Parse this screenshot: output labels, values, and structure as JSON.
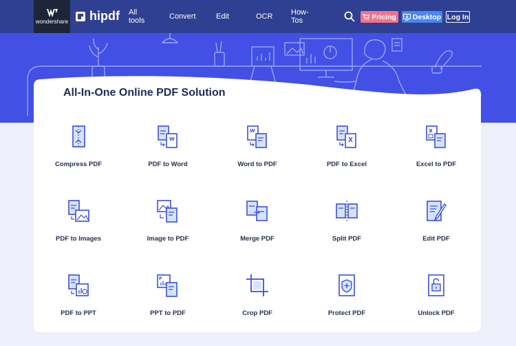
{
  "header": {
    "brand_name": "wondershare",
    "logo_text": "hipdf",
    "nav": [
      "All tools",
      "Convert",
      "Edit",
      "OCR",
      "How-Tos"
    ],
    "pricing_label": "Pricing",
    "desktop_label": "Desktop",
    "login_label": "Log In"
  },
  "main": {
    "title": "All-In-One Online PDF Solution",
    "tools": [
      {
        "label": "Compress PDF",
        "icon": "compress-icon"
      },
      {
        "label": "PDF to Word",
        "icon": "pdf-to-word-icon"
      },
      {
        "label": "Word to PDF",
        "icon": "word-to-pdf-icon"
      },
      {
        "label": "PDF to Excel",
        "icon": "pdf-to-excel-icon"
      },
      {
        "label": "Excel to PDF",
        "icon": "excel-to-pdf-icon"
      },
      {
        "label": "PDF to Images",
        "icon": "pdf-to-images-icon"
      },
      {
        "label": "Image to PDF",
        "icon": "image-to-pdf-icon"
      },
      {
        "label": "Merge PDF",
        "icon": "merge-icon"
      },
      {
        "label": "Split PDF",
        "icon": "split-icon"
      },
      {
        "label": "Edit PDF",
        "icon": "edit-icon"
      },
      {
        "label": "PDF to PPT",
        "icon": "pdf-to-ppt-icon"
      },
      {
        "label": "PPT to PDF",
        "icon": "ppt-to-pdf-icon"
      },
      {
        "label": "Crop PDF",
        "icon": "crop-icon"
      },
      {
        "label": "Protect PDF",
        "icon": "protect-icon"
      },
      {
        "label": "Unlock PDF",
        "icon": "unlock-icon"
      }
    ]
  },
  "colors": {
    "header_bg": "#2f3f91",
    "hero_bg": "#4250e6",
    "icon_blue": "#3a4fd6",
    "icon_fill": "#d6e3ff",
    "pricing": "#f4718a",
    "desktop": "#4a86f0"
  }
}
